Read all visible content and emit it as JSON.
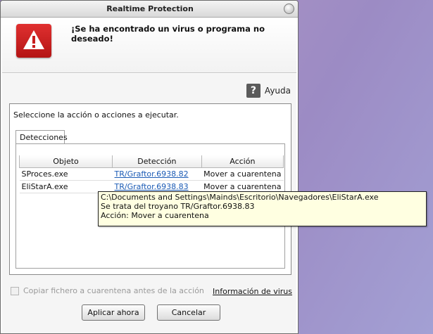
{
  "window": {
    "title": "Realtime Protection"
  },
  "header": {
    "message": "¡Se ha encontrado un virus o programa no deseado!"
  },
  "help": {
    "label": "Ayuda",
    "icon": "help-question-icon"
  },
  "group": {
    "instruction": "Seleccione la acción o acciones a ejecutar."
  },
  "tabs": [
    {
      "label": "Detecciones"
    }
  ],
  "table": {
    "columns": [
      "Objeto",
      "Detección",
      "Acción"
    ],
    "rows": [
      {
        "object": "SProces.exe",
        "detection": "TR/Graftor.6938.82",
        "action": "Mover a cuarentena"
      },
      {
        "object": "EliStarA.exe",
        "detection": "TR/Graftor.6938.83",
        "action": "Mover a cuarentena"
      }
    ]
  },
  "tooltip": {
    "lines": [
      "C:\\Documents and Settings\\Mainds\\Escritorio\\Navegadores\\EliStarA.exe",
      "Se trata del troyano TR/Graftor.6938.83",
      "Acción: Mover a cuarentena"
    ]
  },
  "options": {
    "copy_to_quarantine": {
      "label": "Copiar fichero a cuarentena antes de la acción",
      "checked": false,
      "enabled": false
    },
    "virus_info_link": "Información de virus"
  },
  "buttons": {
    "apply": "Aplicar ahora",
    "cancel": "Cancelar"
  },
  "colors": {
    "alert_red": "#c81e1e",
    "link_blue": "#1b5bb5",
    "tooltip_bg": "#ffffe1"
  }
}
